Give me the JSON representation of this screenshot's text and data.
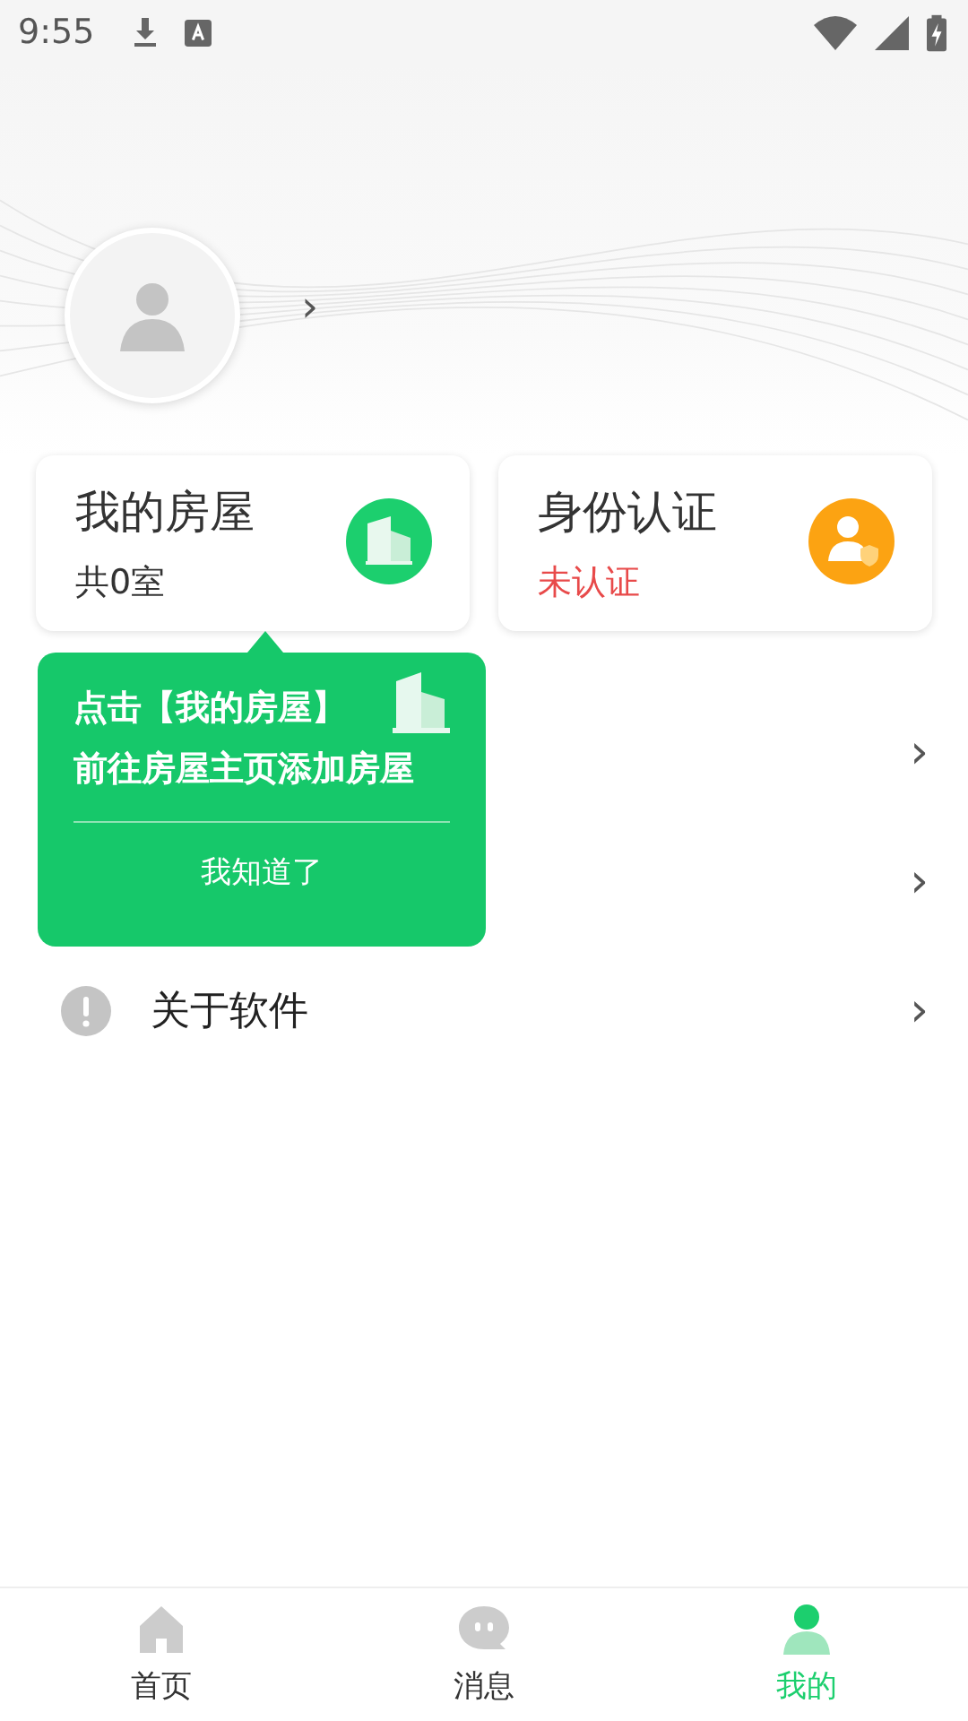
{
  "status_bar": {
    "time": "9:55"
  },
  "profile": {
    "chevron": "›"
  },
  "cards": [
    {
      "kind": "house",
      "title": "我的房屋",
      "subtitle": "共0室",
      "alert": false
    },
    {
      "kind": "identity",
      "title": "身份认证",
      "subtitle": "未认证",
      "alert": true
    }
  ],
  "menu": [
    {
      "kind": "hidden",
      "chevron": "›"
    },
    {
      "kind": "hidden",
      "chevron": "›"
    },
    {
      "kind": "info",
      "label": "关于软件",
      "chevron": "›"
    }
  ],
  "tooltip": {
    "line_1": "点击【我的房屋】",
    "line_2": "前往房屋主页添加房屋",
    "button": "我知道了"
  },
  "tabs": [
    {
      "kind": "home",
      "label": "首页",
      "selected": false
    },
    {
      "kind": "message",
      "label": "消息",
      "selected": false
    },
    {
      "kind": "me",
      "label": "我的",
      "selected": true
    }
  ]
}
